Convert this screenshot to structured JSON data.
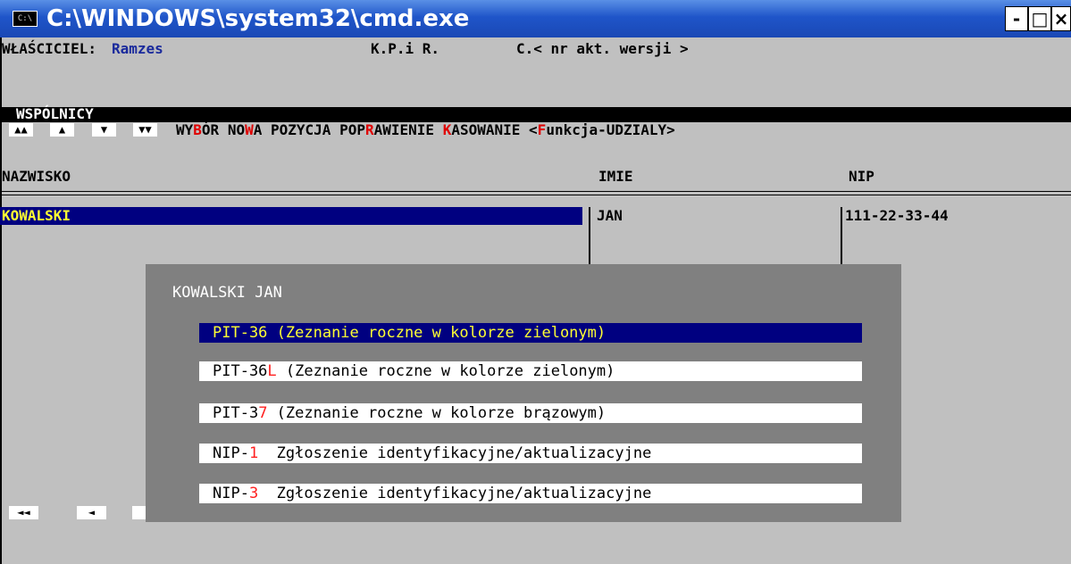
{
  "window": {
    "title": "C:\\WINDOWS\\system32\\cmd.exe",
    "icon_text": "C:\\",
    "minimize_glyph": "-",
    "maximize_glyph": "□",
    "close_glyph": "×"
  },
  "header": {
    "owner_label": "WŁAŚCICIEL:",
    "owner_name": "Ramzes",
    "kpir": "K.P.i R.",
    "version": "C.< nr akt. wersji >"
  },
  "section": {
    "title": "WSPÓLNICY"
  },
  "nav_buttons": [
    "▲▲",
    "▲",
    "▼",
    "▼▼"
  ],
  "menu": {
    "wybor_a": "WY",
    "wybor_hot": "B",
    "wybor_b": "ÓR",
    "nowa_a": "NO",
    "nowa_hot": "W",
    "nowa_b": "A POZYCJA",
    "popr_a": "POP",
    "popr_hot": "R",
    "popr_b": "AWIENIE",
    "kas_hot": "K",
    "kas_b": "ASOWANIE",
    "funk_a": "<",
    "funk_hot": "F",
    "funk_b": "unkcja-UDZIALY>"
  },
  "table": {
    "columns": [
      "NAZWISKO",
      "IMIE",
      "NIP"
    ],
    "rows": [
      {
        "nazwisko": "KOWALSKI",
        "imie": "JAN",
        "nip": "111-22-33-44"
      }
    ]
  },
  "bottom_nav": [
    "◄◄",
    "◄"
  ],
  "popup": {
    "title": "KOWALSKI JAN",
    "options": [
      {
        "code": "PIT-36",
        "hot": "",
        "text": " (Zeznanie roczne w kolorze zielonym)"
      },
      {
        "code": "PIT-36",
        "hot": "L",
        "text": " (Zeznanie roczne w kolorze zielonym)"
      },
      {
        "code": "PIT-3",
        "hot": "7",
        "text": " (Zeznanie roczne w kolorze brązowym)"
      },
      {
        "code": "NIP-",
        "hot": "1",
        "text": "  Zgłoszenie identyfikacyjne/aktualizacyjne"
      },
      {
        "code": "NIP-",
        "hot": "3",
        "text": "  Zgłoszenie identyfikacyjne/aktualizacyjne"
      }
    ]
  },
  "colors": {
    "titlebar": "#1f55c9",
    "console_bg": "#c0c0c0",
    "selection_bg": "#000080",
    "selection_fg": "#ffff33",
    "hotkey": "#ff2020",
    "popup_bg": "#808080"
  }
}
